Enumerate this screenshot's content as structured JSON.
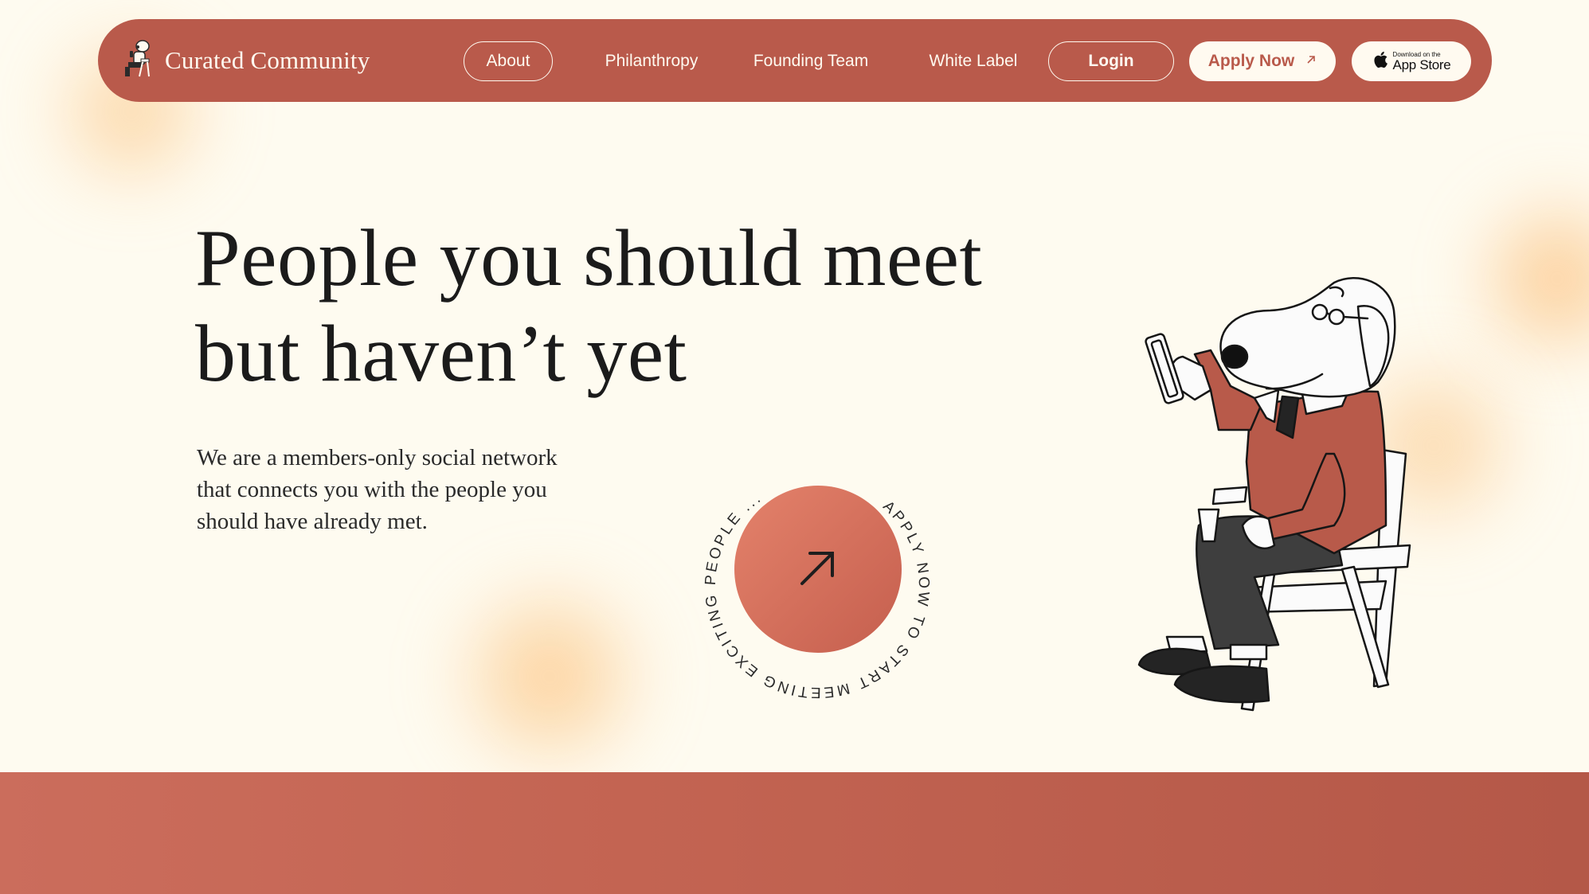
{
  "nav": {
    "brand": "Curated Community",
    "links": [
      "About",
      "Philanthropy",
      "Founding Team",
      "White Label"
    ],
    "login": "Login",
    "apply": "Apply Now",
    "appstore_small": "Download on the",
    "appstore_big": "App Store"
  },
  "hero": {
    "headline_line1": "People you should meet",
    "headline_line2": "but haven’t yet",
    "subtext": "We are a members-only social network that connects you with the people you should have already met."
  },
  "cta": {
    "ring_text": "APPLY NOW TO START MEETING EXCITING PEOPLE ..."
  },
  "colors": {
    "background": "#fefbf0",
    "brand": "#b95a4b",
    "cta_accent": "#e4826b"
  },
  "icons": [
    "dog-logo-icon",
    "arrow-up-right-icon",
    "apple-icon",
    "dog-illustration"
  ]
}
